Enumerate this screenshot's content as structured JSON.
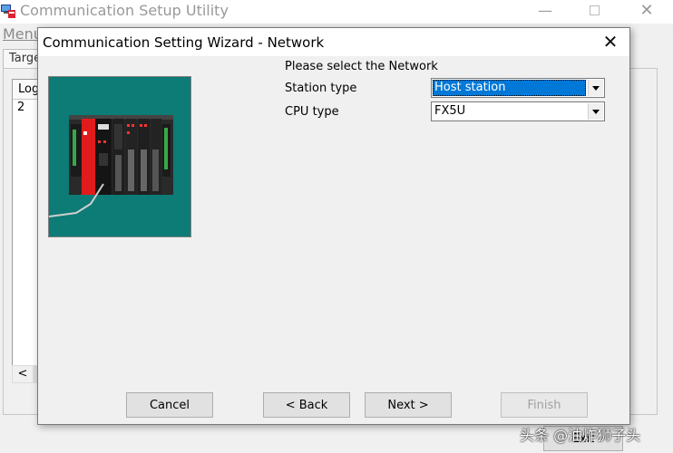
{
  "parent_window": {
    "title": "Communication Setup Utility",
    "menu_label": "Menu",
    "tab_label": "Targe",
    "list_header": "Log",
    "list_rows": [
      "2"
    ],
    "scroll_left_glyph": "<",
    "exit_label": "Exit",
    "minimize_glyph": "—",
    "close_glyph": "✕"
  },
  "dialog": {
    "title": "Communication Setting Wizard - Network",
    "close_glyph": "✕",
    "prompt": "Please select the Network",
    "station_type": {
      "label": "Station type",
      "value": "Host station"
    },
    "cpu_type": {
      "label": "CPU type",
      "value": "FX5U"
    },
    "buttons": {
      "cancel": "Cancel",
      "back": "< Back",
      "next": "Next >",
      "finish": "Finish"
    }
  },
  "watermark": "头条 @油炸狮子头",
  "colors": {
    "illustration_bg": "#0d7b76",
    "selection": "#0078d7",
    "plc_red_module": "#e11b1b"
  },
  "icons": {
    "app_icon": "computer-network-icon",
    "dropdown": "chevron-down-icon"
  }
}
